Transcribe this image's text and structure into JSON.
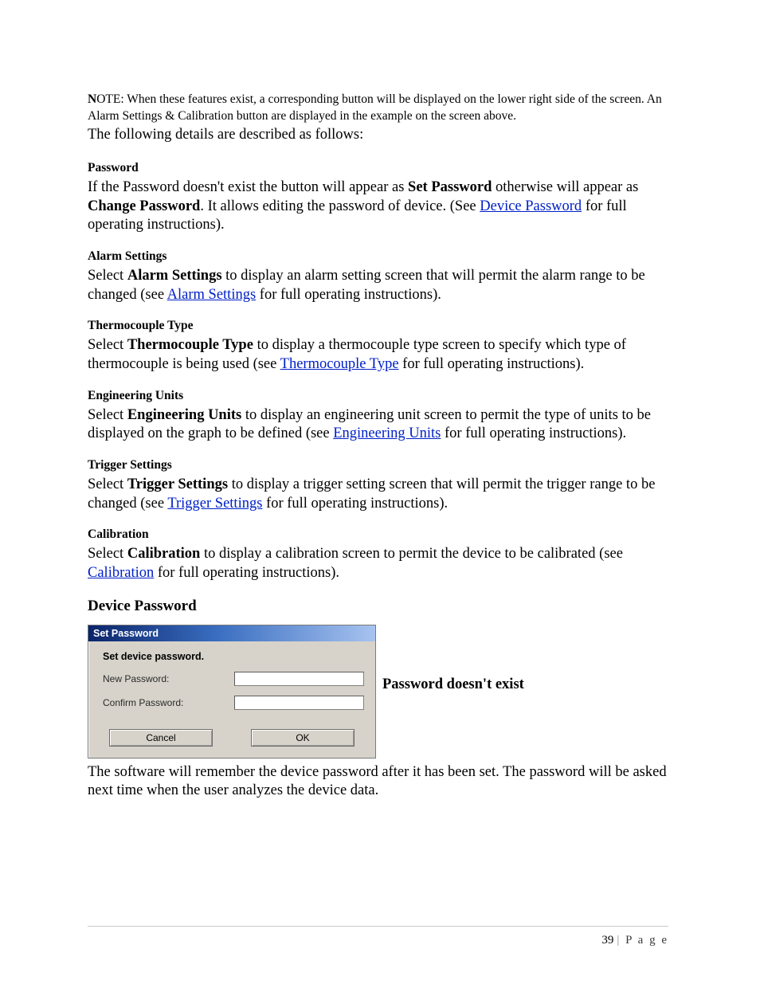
{
  "note": {
    "text": "OTE: When these features exist, a corresponding button will be displayed on the lower right side of the screen. An Alarm Settings & Calibration button are displayed in the example on the screen above.",
    "leading_bold": "N"
  },
  "follow": "The following details are described as follows:",
  "sections": {
    "password": {
      "title": "Password",
      "pre": "If the Password doesn't exist the button will appear as ",
      "bold1": "Set Password",
      "mid1": " otherwise will appear as ",
      "bold2": "Change Password",
      "mid2": ". It allows editing the password of device. (See ",
      "link": "Device Password",
      "post": " for full operating instructions)."
    },
    "alarm": {
      "title": "Alarm Settings",
      "pre": "Select ",
      "bold": "Alarm Settings",
      "mid": " to display an alarm setting screen that will permit the alarm range to be changed (see ",
      "link": "Alarm Settings",
      "post": " for full operating instructions)."
    },
    "thermo": {
      "title": "Thermocouple Type",
      "pre": "Select ",
      "bold": "Thermocouple Type",
      "mid": " to display a thermocouple type screen to specify which type of thermocouple is being used (see ",
      "link": "Thermocouple Type",
      "post": " for full operating instructions)."
    },
    "eng": {
      "title": "Engineering Units",
      "pre": "Select ",
      "bold": "Engineering Units",
      "mid": " to display an engineering unit screen to permit the type of units to be displayed on the graph to be defined (see ",
      "link": "Engineering Units",
      "post": " for full operating instructions)."
    },
    "trigger": {
      "title": "Trigger Settings",
      "pre": "Select ",
      "bold": "Trigger Settings",
      "mid": " to display a trigger setting screen that will permit the trigger range to be changed (see ",
      "link": "Trigger Settings",
      "post": " for full operating instructions)."
    },
    "calib": {
      "title": "Calibration",
      "pre": "Select ",
      "bold": "Calibration",
      "mid": " to display a calibration screen to permit the device to be calibrated (see ",
      "link": "Calibration",
      "post": " for full operating instructions)."
    }
  },
  "device_password_heading": "Device Password",
  "dialog": {
    "title": "Set Password",
    "caption": "Set device password.",
    "fields": {
      "new_pw_label": "New Password:",
      "new_pw_value": "",
      "confirm_label": "Confirm Password:",
      "confirm_value": ""
    },
    "buttons": {
      "cancel": "Cancel",
      "ok": "OK"
    }
  },
  "dialog_side_text": "Password doesn't exist",
  "after_dialog": "The software will remember the device password after it has been set. The password will be asked next time when the user analyzes the device data.",
  "footer": {
    "page_num": "39",
    "bar": "|",
    "word": "P a g e"
  }
}
